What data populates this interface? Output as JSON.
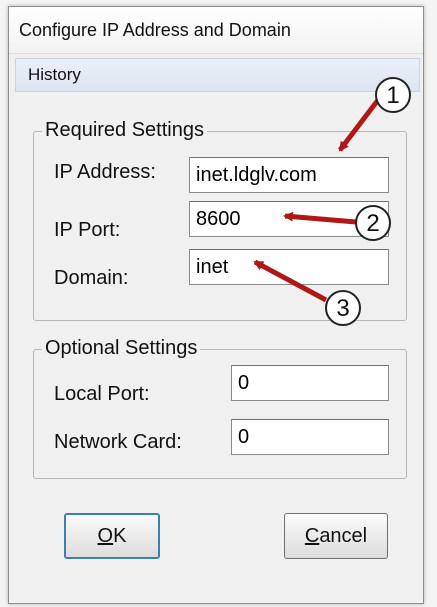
{
  "window": {
    "title": "Configure IP Address and Domain"
  },
  "menu": {
    "history": "History"
  },
  "required": {
    "legend": "Required Settings",
    "ip_address_label": "IP Address:",
    "ip_address_value": "inet.ldglv.com",
    "ip_port_label": "IP Port:",
    "ip_port_value": "8600",
    "domain_label": "Domain:",
    "domain_value": "inet"
  },
  "optional": {
    "legend": "Optional Settings",
    "local_port_label": "Local Port:",
    "local_port_value": "0",
    "network_card_label": "Network Card:",
    "network_card_value": "0"
  },
  "buttons": {
    "ok_mnemonic": "O",
    "ok_rest": "K",
    "cancel_mnemonic": "C",
    "cancel_rest": "ancel"
  },
  "callouts": {
    "one": "1",
    "two": "2",
    "three": "3"
  },
  "colors": {
    "arrow": "#b01818",
    "focus": "#3c7fb1"
  }
}
